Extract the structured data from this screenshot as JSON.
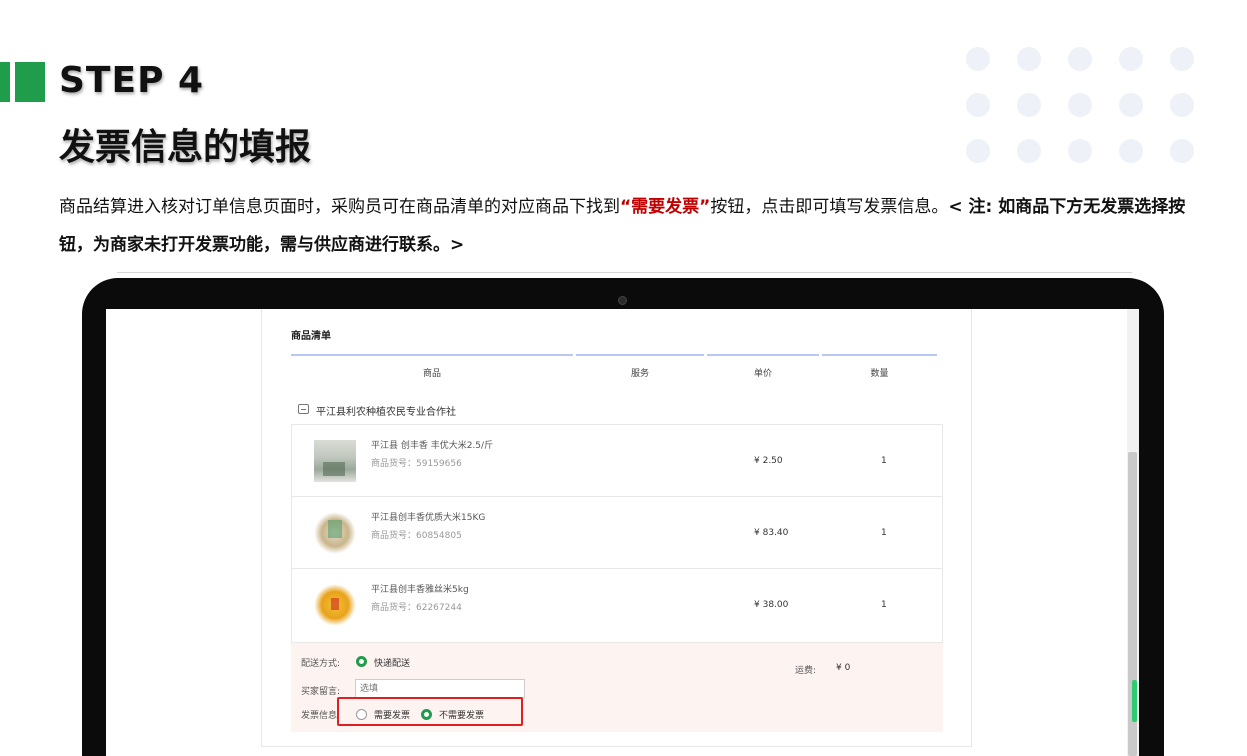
{
  "header": {
    "step": "STEP 4",
    "title": "发票信息的填报"
  },
  "description": {
    "part1": "商品结算进入核对订单信息页面时，采购员可在商品清单的对应商品下找到",
    "highlight": "“需要发票”",
    "part2": "按钮，点击即可填写发票信息。",
    "note": "< 注: 如商品下方无发票选择按钮，为商家未打开发票功能，需与供应商进行联系。>"
  },
  "order": {
    "section_title": "商品清单",
    "columns": [
      "商品",
      "服务",
      "单价",
      "数量"
    ],
    "shop_name": "平江县利农种植农民专业合作社",
    "items": [
      {
        "name": "平江县 创丰香 丰优大米2.5/斤",
        "code": "商品货号：59159656",
        "price": "¥ 2.50",
        "qty": "1"
      },
      {
        "name": "平江县创丰香优质大米15KG",
        "code": "商品货号：60854805",
        "price": "¥ 83.40",
        "qty": "1"
      },
      {
        "name": "平江县创丰香雅丝米5kg",
        "code": "商品货号：62267244",
        "price": "¥ 38.00",
        "qty": "1"
      }
    ],
    "delivery_label": "配送方式:",
    "delivery_option": "快递配送",
    "shipping_label": "运费:",
    "shipping_value": "¥ 0",
    "remark_label": "买家留言:",
    "remark_value": "选填",
    "invoice_label": "发票信息:",
    "invoice_need": "需要发票",
    "invoice_no_need": "不需要发票"
  },
  "colors": {
    "accent_green": "#1f9d4a",
    "highlight_red": "#c00000",
    "table_header_line": "#b8c8f2"
  }
}
